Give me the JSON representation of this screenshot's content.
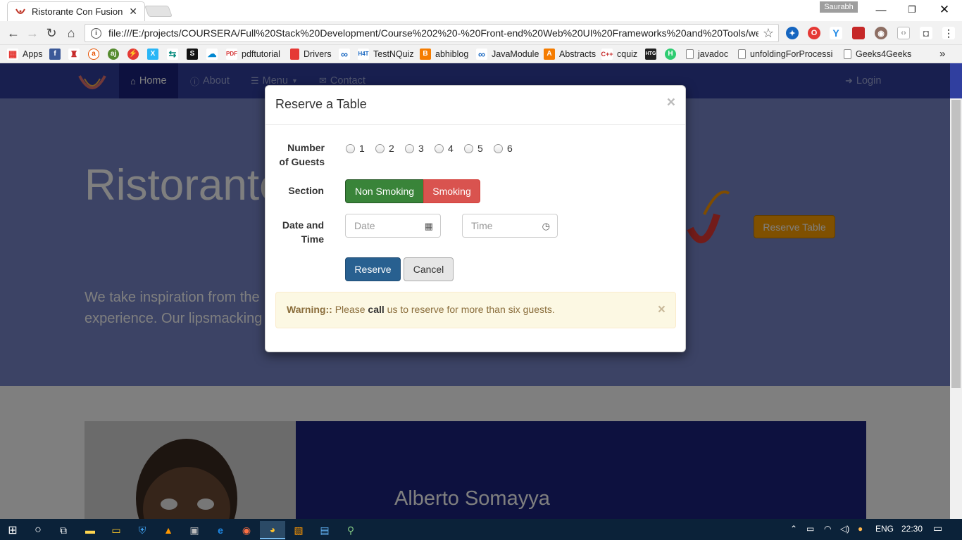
{
  "browser": {
    "tab_title": "Ristorante Con Fusion",
    "user_badge": "Saurabh",
    "url": "file:///E:/projects/COURSERA/Full%20Stack%20Development/Course%202%20-%20Front-end%20Web%20UI%20Frameworks%20and%20Tools/week%",
    "bookmarks": [
      "Apps",
      "pdftutorial",
      "Drivers",
      "TestNQuiz",
      "abhiblog",
      "JavaModule",
      "Abstracts",
      "cquiz",
      "javadoc",
      "unfoldingForProcessin",
      "Geeks4Geeks"
    ],
    "overflow": "»"
  },
  "navbar": {
    "items": [
      "Home",
      "About",
      "Menu",
      "Contact"
    ],
    "login": "Login"
  },
  "jumbotron": {
    "title": "Ristorante",
    "lead_line1": "We take inspiration from the",
    "lead_line2": "experience. Our lipsmacking",
    "reserve_button": "Reserve Table"
  },
  "leader": {
    "name": "Alberto Somayya"
  },
  "modal": {
    "title": "Reserve a Table",
    "close": "×",
    "guests_label_1": "Number",
    "guests_label_2": "of Guests",
    "guest_options": [
      "1",
      "2",
      "3",
      "4",
      "5",
      "6"
    ],
    "section_label": "Section",
    "non_smoking": "Non Smoking",
    "smoking": "Smoking",
    "datetime_label_1": "Date and",
    "datetime_label_2": "Time",
    "date_placeholder": "Date",
    "time_placeholder": "Time",
    "reserve": "Reserve",
    "cancel": "Cancel",
    "alert_strong": "Warning::",
    "alert_pre": "Please",
    "alert_call": "call",
    "alert_post": "us to reserve for more than six guests.",
    "alert_close": "×"
  },
  "taskbar": {
    "lang": "ENG",
    "time": "22:30"
  },
  "colors": {
    "navbar": "#303f9f",
    "jumbotron": "#7986cb",
    "success": "#398439",
    "danger": "#c9302c",
    "primary": "#286090",
    "warning_bg": "#fcf8e3"
  }
}
